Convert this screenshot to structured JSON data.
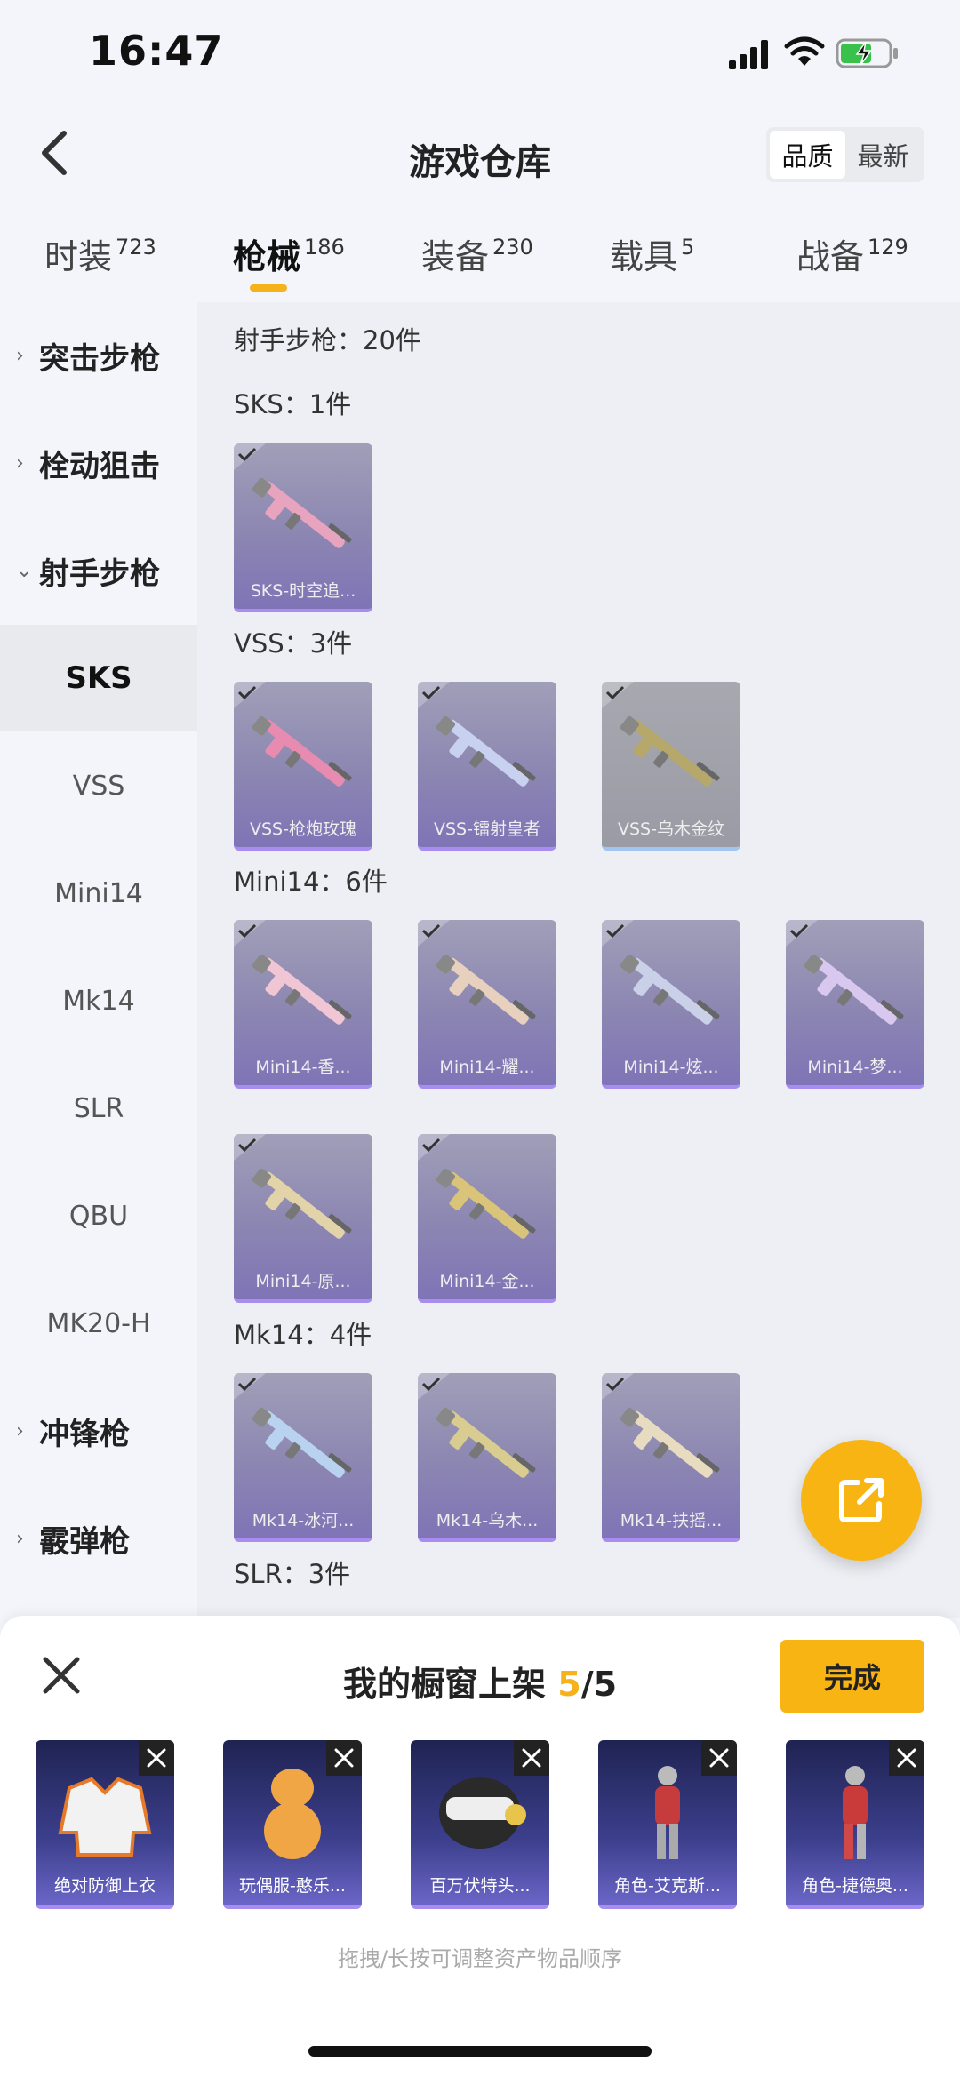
{
  "status_bar": {
    "time": "16:47"
  },
  "header": {
    "title": "游戏仓库",
    "sort_options": [
      "品质",
      "最新"
    ]
  },
  "categories": [
    {
      "label": "时装",
      "count": "723"
    },
    {
      "label": "枪械",
      "count": "186"
    },
    {
      "label": "装备",
      "count": "230"
    },
    {
      "label": "载具",
      "count": "5"
    },
    {
      "label": "战备",
      "count": "129"
    }
  ],
  "sidebar": {
    "groups": [
      "突击步枪",
      "栓动狙击",
      "射手步枪",
      "冲锋枪",
      "霰弹枪"
    ],
    "sub_items": [
      "SKS",
      "VSS",
      "Mini14",
      "Mk14",
      "SLR",
      "QBU",
      "MK20-H"
    ]
  },
  "main": {
    "summary": "射手步枪：20件",
    "sections": [
      {
        "label": "SKS：1件",
        "items": [
          "SKS-时空追..."
        ]
      },
      {
        "label": "VSS：3件",
        "items": [
          "VSS-枪炮玫瑰",
          "VSS-镭射皇者",
          "VSS-乌木金纹"
        ]
      },
      {
        "label": "Mini14：6件",
        "items": [
          "Mini14-香...",
          "Mini14-耀...",
          "Mini14-炫...",
          "Mini14-梦...",
          "Mini14-原...",
          "Mini14-金..."
        ]
      },
      {
        "label": "Mk14：4件",
        "items": [
          "Mk14-冰河...",
          "Mk14-乌木...",
          "Mk14-扶摇..."
        ]
      },
      {
        "label": "SLR：3件",
        "items": []
      }
    ]
  },
  "sheet": {
    "title": "我的橱窗上架",
    "count": "5",
    "total": "/5",
    "done_label": "完成",
    "items": [
      "绝对防御上衣",
      "玩偶服-憨乐...",
      "百万伏特头...",
      "角色-艾克斯...",
      "角色-捷德奥..."
    ],
    "hint": "拖拽/长按可调整资产物品顺序"
  },
  "colors": {
    "accent": "#f8b412",
    "card_purple": "#8c86b2"
  }
}
